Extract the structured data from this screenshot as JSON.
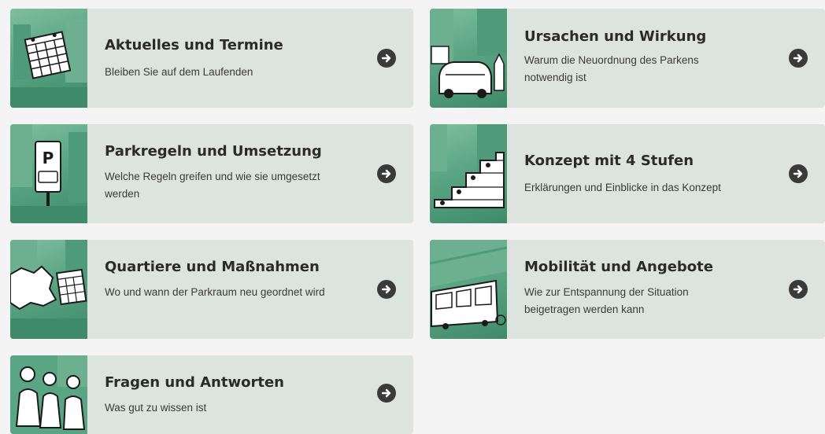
{
  "cards": [
    {
      "title": "Aktuelles und Termine",
      "description": "Bleiben Sie auf dem Laufenden",
      "icon": "calendar-icon"
    },
    {
      "title": "Ursachen und Wirkung",
      "description": "Warum die Neuordnung des Parkens notwendig ist",
      "icon": "parked-cars-icon"
    },
    {
      "title": "Parkregeln und Umsetzung",
      "description": "Welche Regeln greifen und wie sie umgesetzt werden",
      "icon": "parking-sign-icon"
    },
    {
      "title": "Konzept mit 4 Stufen",
      "description": "Erklärungen und Einblicke in das Konzept",
      "icon": "stairs-icon"
    },
    {
      "title": "Quartiere und Maßnahmen",
      "description": "Wo und wann der Parkraum neu geordnet wird",
      "icon": "map-calendar-icon"
    },
    {
      "title": "Mobilität und Angebote",
      "description": "Wie zur Entspannung der Situation beigetragen werden kann",
      "icon": "tram-icon"
    },
    {
      "title": "Fragen und Antworten",
      "description": "Was gut zu wissen ist",
      "icon": "people-talking-icon"
    }
  ],
  "colors": {
    "card_bg": "#dde4e0",
    "thumb_green": "#5aa583",
    "arrow_bg": "#3a3a3a",
    "page_bg": "#f4f4f4"
  }
}
